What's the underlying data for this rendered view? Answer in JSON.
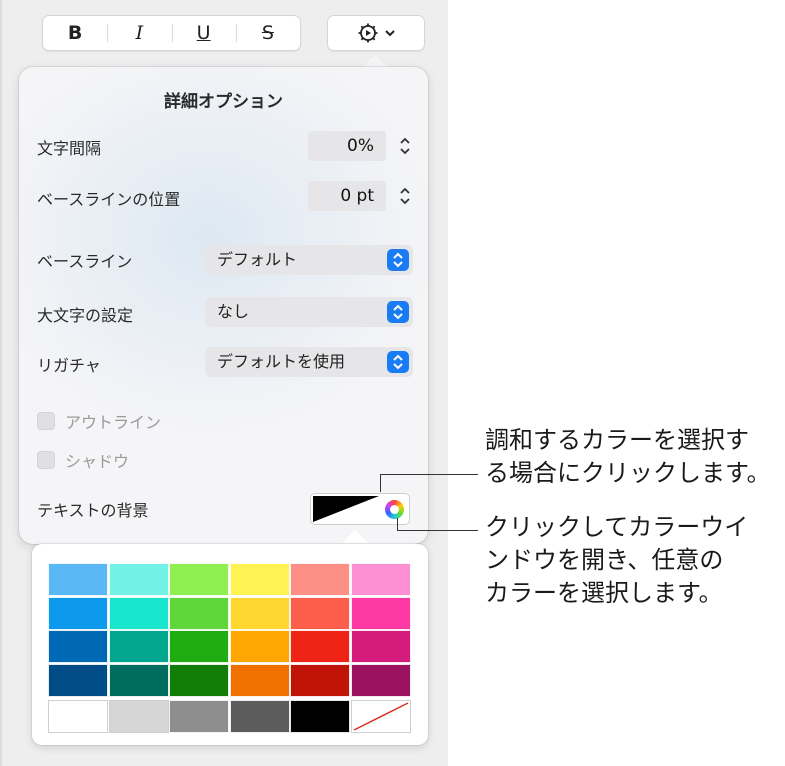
{
  "toolbar": {
    "bold": "B",
    "italic": "I",
    "underline": "U",
    "strike": "S",
    "gear_icon": "gear-icon"
  },
  "popover": {
    "title": "詳細オプション",
    "rows": {
      "char_spacing": {
        "label": "文字間隔",
        "value": "0%"
      },
      "baseline_shift": {
        "label": "ベースラインの位置",
        "value": "0 pt"
      },
      "baseline": {
        "label": "ベースライン",
        "value": "デフォルト"
      },
      "capitalization": {
        "label": "大文字の設定",
        "value": "なし"
      },
      "ligatures": {
        "label": "リガチャ",
        "value": "デフォルトを使用"
      }
    },
    "outline": "アウトライン",
    "shadow": "シャドウ",
    "text_background": "テキストの背景"
  },
  "palette": {
    "rows": [
      [
        "#5ab8f5",
        "#72f2e6",
        "#8ef050",
        "#fff253",
        "#fe8f86",
        "#fd8fd3"
      ],
      [
        "#0e9aec",
        "#19e5cd",
        "#5fd73b",
        "#ffd731",
        "#fd5e4c",
        "#ff39a4"
      ],
      [
        "#0069b5",
        "#03a68e",
        "#1fad12",
        "#fea700",
        "#f02317",
        "#d51b7b"
      ],
      [
        "#004c87",
        "#006b5f",
        "#127d08",
        "#f07000",
        "#c01408",
        "#9a1260"
      ],
      [
        "#ffffff",
        "#d5d5d5",
        "#8e8e8e",
        "#5c5c5c",
        "#000000",
        "none"
      ]
    ]
  },
  "callouts": {
    "harmony": [
      "調和するカラーを選択す",
      "る場合にクリックします。"
    ],
    "color_window": [
      "クリックしてカラーウイ",
      "ンドウを開き、任意の",
      "カラーを選択します。"
    ]
  }
}
